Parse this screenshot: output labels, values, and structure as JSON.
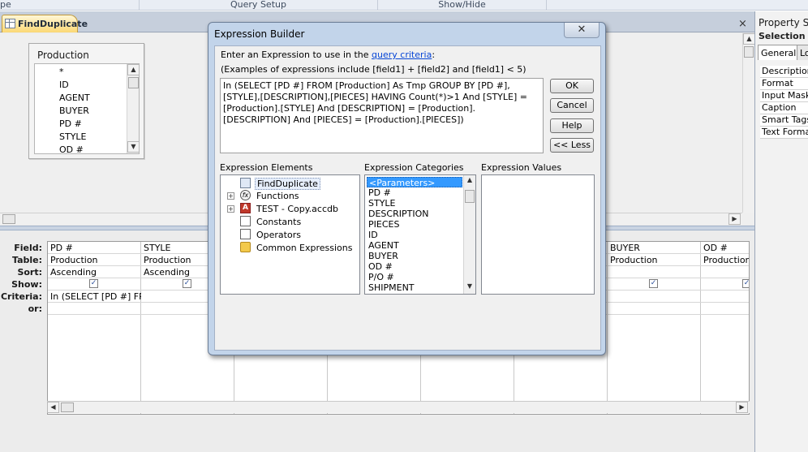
{
  "ribbon": {
    "groups": [
      "pe",
      "Query Setup",
      "Show/Hide"
    ]
  },
  "document_tab": {
    "label": "FindDuplicate",
    "close_glyph": "×"
  },
  "table_box": {
    "title": "Production",
    "fields": [
      "*",
      "ID",
      "AGENT",
      "BUYER",
      "PD #",
      "STYLE",
      "OD #"
    ]
  },
  "grid": {
    "row_labels": [
      "Field:",
      "Table:",
      "Sort:",
      "Show:",
      "Criteria:",
      "or:"
    ],
    "columns": [
      {
        "field": "PD #",
        "table": "Production",
        "sort": "Ascending",
        "show": true,
        "criteria": "In (SELECT [PD #] FRO"
      },
      {
        "field": "STYLE",
        "table": "Production",
        "sort": "Ascending",
        "show": true,
        "criteria": ""
      },
      {
        "field": "",
        "table": "",
        "sort": "",
        "show": false,
        "criteria": ""
      },
      {
        "field": "",
        "table": "",
        "sort": "",
        "show": false,
        "criteria": ""
      },
      {
        "field": "",
        "table": "",
        "sort": "",
        "show": false,
        "criteria": ""
      },
      {
        "field": "",
        "table": "",
        "sort": "",
        "show": false,
        "criteria": ""
      },
      {
        "field": "BUYER",
        "table": "Production",
        "sort": "",
        "show": true,
        "criteria": ""
      },
      {
        "field": "OD #",
        "table": "Production",
        "sort": "",
        "show": true,
        "criteria": ""
      }
    ],
    "check_glyph": "✓"
  },
  "property_sheet": {
    "title": "Property Sh",
    "selection_label": "Selection typ",
    "tabs": [
      "General",
      "Lo"
    ],
    "properties": [
      "Description",
      "Format",
      "Input Mask",
      "Caption",
      "Smart Tags",
      "Text Forma"
    ]
  },
  "dialog": {
    "title": "Expression Builder",
    "close_glyph": "✕",
    "prompt_prefix": "Enter an Expression to use in the",
    "prompt_link": "query criteria",
    "prompt_suffix": ":",
    "examples": "(Examples of expressions include [field1] + [field2] and [field1] < 5)",
    "expression": "In (SELECT [PD #] FROM [Production] As Tmp GROUP BY [PD #],[STYLE],[DESCRIPTION],[PIECES] HAVING Count(*)>1  And [STYLE] = [Production].[STYLE] And [DESCRIPTION] = [Production].[DESCRIPTION] And [PIECES] = [Production].[PIECES])",
    "buttons": {
      "ok": "OK",
      "cancel": "Cancel",
      "help": "Help",
      "less": "<< Less"
    },
    "elements_label": "Expression Elements",
    "categories_label": "Expression Categories",
    "values_label": "Expression Values",
    "elements": [
      {
        "label": "FindDuplicate",
        "icon": "query-icon",
        "expander": ""
      },
      {
        "label": "Functions",
        "icon": "function-icon",
        "expander": "+"
      },
      {
        "label": "TEST - Copy.accdb",
        "icon": "database-icon",
        "expander": "+"
      },
      {
        "label": "Constants",
        "icon": "constants-icon",
        "expander": ""
      },
      {
        "label": "Operators",
        "icon": "operators-icon",
        "expander": ""
      },
      {
        "label": "Common Expressions",
        "icon": "common-expressions-icon",
        "expander": ""
      }
    ],
    "categories": [
      "<Parameters>",
      "PD #",
      "STYLE",
      "DESCRIPTION",
      "PIECES",
      "ID",
      "AGENT",
      "BUYER",
      "OD #",
      "P/O #",
      "SHIPMENT"
    ],
    "icon_glyphs": {
      "function": "fx",
      "database": "A"
    }
  },
  "scroll_glyphs": {
    "up": "▲",
    "down": "▼",
    "left": "◀",
    "right": "▶"
  }
}
